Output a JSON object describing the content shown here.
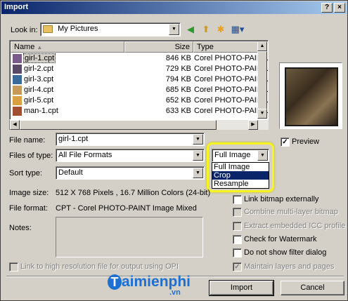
{
  "window": {
    "title": "Import",
    "help_glyph": "?",
    "close_glyph": "×"
  },
  "lookin": {
    "label": "Look in:",
    "value": "My Pictures"
  },
  "toolbar": {
    "back": "◀",
    "up": "⬆",
    "newfolder": "✱",
    "views": "▦▾"
  },
  "columns": {
    "name": "Name",
    "size": "Size",
    "type": "Type"
  },
  "files": [
    {
      "name": "girl-1.cpt",
      "size": "846 KB",
      "type": "Corel PHOTO-PAIN...",
      "selected": true,
      "color": "#7a5c8a"
    },
    {
      "name": "girl-2.cpt",
      "size": "729 KB",
      "type": "Corel PHOTO-PAIN...",
      "selected": false,
      "color": "#5a4a6a"
    },
    {
      "name": "girl-3.cpt",
      "size": "794 KB",
      "type": "Corel PHOTO-PAIN...",
      "selected": false,
      "color": "#3a6a9a"
    },
    {
      "name": "girl-4.cpt",
      "size": "685 KB",
      "type": "Corel PHOTO-PAIN...",
      "selected": false,
      "color": "#c89a5a"
    },
    {
      "name": "girl-5.cpt",
      "size": "652 KB",
      "type": "Corel PHOTO-PAIN...",
      "selected": false,
      "color": "#d8a040"
    },
    {
      "name": "man-1.cpt",
      "size": "633 KB",
      "type": "Corel PHOTO-PAIN...",
      "selected": false,
      "color": "#a05030"
    }
  ],
  "form": {
    "filename_label": "File name:",
    "filename_value": "girl-1.cpt",
    "filetype_label": "Files of type:",
    "filetype_value": "All File Formats",
    "sorttype_label": "Sort type:",
    "sorttype_value": "Default",
    "imagesize_label": "Image size:",
    "imagesize_value": "512 X 768 Pixels , 16.7 Million Colors (24-bit)",
    "fileformat_label": "File format:",
    "fileformat_value": "CPT - Corel PHOTO-PAINT Image Mixed",
    "notes_label": "Notes:"
  },
  "import_mode": {
    "value": "Full Image",
    "options": [
      "Full Image",
      "Crop",
      "Resample"
    ],
    "highlighted": "Crop"
  },
  "preview": {
    "label": "Preview",
    "checked": true
  },
  "options": [
    {
      "label": "Link bitmap externally",
      "checked": false,
      "disabled": false
    },
    {
      "label": "Combine multi-layer bitmap",
      "checked": false,
      "disabled": true
    },
    {
      "label": "Extract embedded ICC profile",
      "checked": false,
      "disabled": true
    },
    {
      "label": "Check for Watermark",
      "checked": false,
      "disabled": false
    },
    {
      "label": "Do not show filter dialog",
      "checked": false,
      "disabled": false
    },
    {
      "label": "Maintain layers and pages",
      "checked": true,
      "disabled": true
    }
  ],
  "link_highres": {
    "label": "Link to high resolution file for output using OPI",
    "checked": false
  },
  "buttons": {
    "import": "Import",
    "cancel": "Cancel"
  },
  "watermark": {
    "brand": "aimienphi",
    "suffix": ".vn",
    "color": "#1d6fd1"
  }
}
